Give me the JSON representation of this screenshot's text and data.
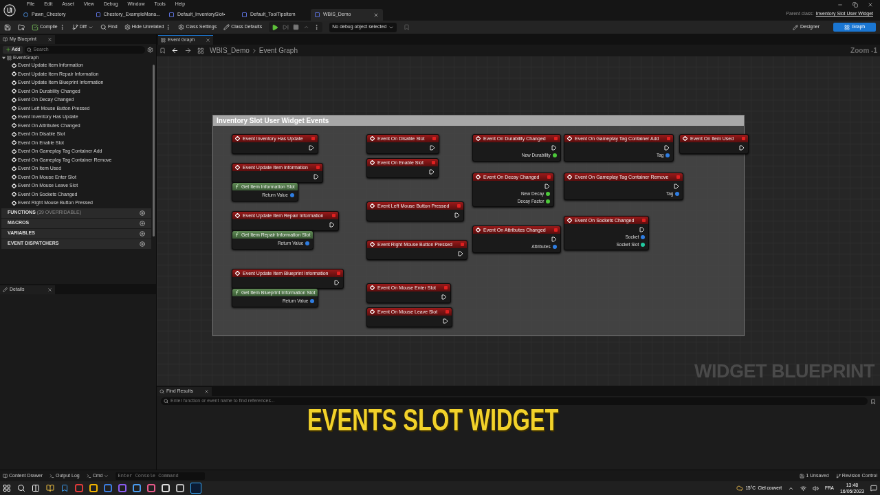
{
  "menu": [
    "File",
    "Edit",
    "Asset",
    "View",
    "Debug",
    "Window",
    "Tools",
    "Help"
  ],
  "document_tabs": [
    {
      "label": "Pawn_Chestory",
      "selected": false
    },
    {
      "label": "Chestory_ExampleMana...",
      "selected": false
    },
    {
      "label": "Default_InventorySlot•",
      "selected": false
    },
    {
      "label": "Default_ToolTipsItem",
      "selected": false
    },
    {
      "label": "WBIS_Demo",
      "selected": true
    }
  ],
  "parent_class": {
    "label": "Parent class:",
    "value": "Inventory Slot User Widget"
  },
  "toolbar": {
    "compile": "Compile",
    "diff": "Diff",
    "find": "Find",
    "hide_unrelated": "Hide Unrelated",
    "class_settings": "Class Settings",
    "class_defaults": "Class Defaults",
    "debug_object": "No debug object selected",
    "modes": [
      {
        "label": "Designer",
        "selected": false
      },
      {
        "label": "Graph",
        "selected": true
      }
    ]
  },
  "my_blueprint": {
    "tab": "My Blueprint",
    "add": "Add",
    "search_placeholder": "Search",
    "graph": {
      "label": "EventGraph",
      "expanded": true
    },
    "events": [
      "Event Update Item Information",
      "Event Update Item Repair Information",
      "Event Update Item Blueprint Information",
      "Event On Durability Changed",
      "Event On Decay Changed",
      "Event Left Mouse Button Pressed",
      "Event Inventory Has Update",
      "Event On Attributes Changed",
      "Event On Disable Slot",
      "Event On Enable Slot",
      "Event On Gameplay Tag Container Add",
      "Event On Gameplay Tag Container Remove",
      "Event On Item Used",
      "Event On Mouse Enter Slot",
      "Event On Mouse Leave Slot",
      "Event On Sockets Changed",
      "Event Right Mouse Button Pressed"
    ],
    "sections": [
      {
        "label": "FUNCTIONS",
        "note": "(39 OVERRIDABLE)"
      },
      {
        "label": "MACROS"
      },
      {
        "label": "VARIABLES"
      },
      {
        "label": "EVENT DISPATCHERS"
      }
    ]
  },
  "details": {
    "tab": "Details"
  },
  "graph": {
    "tab": "Event Graph",
    "breadcrumb": [
      "WBIS_Demo",
      "Event Graph"
    ],
    "zoom": "Zoom -1",
    "watermark": "WIDGET BLUEPRINT",
    "comment": "Inventory Slot User Widget Events",
    "nodes": [
      {
        "kind": "event",
        "title": "Event Inventory Has Update"
      },
      {
        "kind": "event",
        "title": "Event Update Item Information"
      },
      {
        "kind": "function",
        "title": "Get Item Information Slot",
        "outputs": [
          {
            "label": "Return Value",
            "color": "#2f7de1"
          }
        ]
      },
      {
        "kind": "event",
        "title": "Event Update Item Repair Information"
      },
      {
        "kind": "function",
        "title": "Get Item Repair Information Slot",
        "outputs": [
          {
            "label": "Return Value",
            "color": "#2f7de1"
          }
        ]
      },
      {
        "kind": "event",
        "title": "Event Update Item Blueprint Information"
      },
      {
        "kind": "function",
        "title": "Get Item Blueprint Information Slot",
        "outputs": [
          {
            "label": "Return Value",
            "color": "#2f7de1"
          }
        ]
      },
      {
        "kind": "event",
        "title": "Event On Disable Slot"
      },
      {
        "kind": "event",
        "title": "Event On Enable Slot"
      },
      {
        "kind": "event",
        "title": "Event Left Mouse Button Pressed"
      },
      {
        "kind": "event",
        "title": "Event Right Mouse Button Pressed"
      },
      {
        "kind": "event",
        "title": "Event On Mouse Enter Slot"
      },
      {
        "kind": "event",
        "title": "Event On Mouse Leave Slot"
      },
      {
        "kind": "event",
        "title": "Event On Durability Changed",
        "outputs": [
          {
            "label": "New Durability",
            "color": "#4cc93a"
          }
        ]
      },
      {
        "kind": "event",
        "title": "Event On Decay Changed",
        "outputs": [
          {
            "label": "New Decay",
            "color": "#4cc93a"
          },
          {
            "label": "Decay Factor",
            "color": "#4cc93a"
          }
        ]
      },
      {
        "kind": "event",
        "title": "Event On Attributes Changed",
        "outputs": [
          {
            "label": "Attributes",
            "color": "#2f7de1"
          }
        ]
      },
      {
        "kind": "event",
        "title": "Event On Gameplay Tag Container Add",
        "outputs": [
          {
            "label": "Tag",
            "color": "#2f7de1"
          }
        ]
      },
      {
        "kind": "event",
        "title": "Event On Gameplay Tag Container Remove",
        "outputs": [
          {
            "label": "Tag",
            "color": "#2f7de1"
          }
        ]
      },
      {
        "kind": "event",
        "title": "Event On Sockets Changed",
        "outputs": [
          {
            "label": "Socket",
            "color": "#2f7de1"
          },
          {
            "label": "Socket Slot",
            "color": "#22c9a0"
          }
        ]
      },
      {
        "kind": "event",
        "title": "Event On Item Used"
      }
    ]
  },
  "find_results": {
    "tab": "Find Results",
    "placeholder": "Enter function or event name to find references..."
  },
  "caption": "EVENTS SLOT WIDGET",
  "status_bar": {
    "content_drawer": "Content Drawer",
    "output_log": "Output Log",
    "cmd": "Cmd",
    "console_placeholder": "Enter Console Command",
    "unsaved": "1 Unsaved",
    "revision_control": "Revision Control"
  },
  "taskbar": {
    "weather": "15°C  Ciel couvert",
    "language": "FRA",
    "time": "13:48",
    "date": "16/05/2023"
  }
}
